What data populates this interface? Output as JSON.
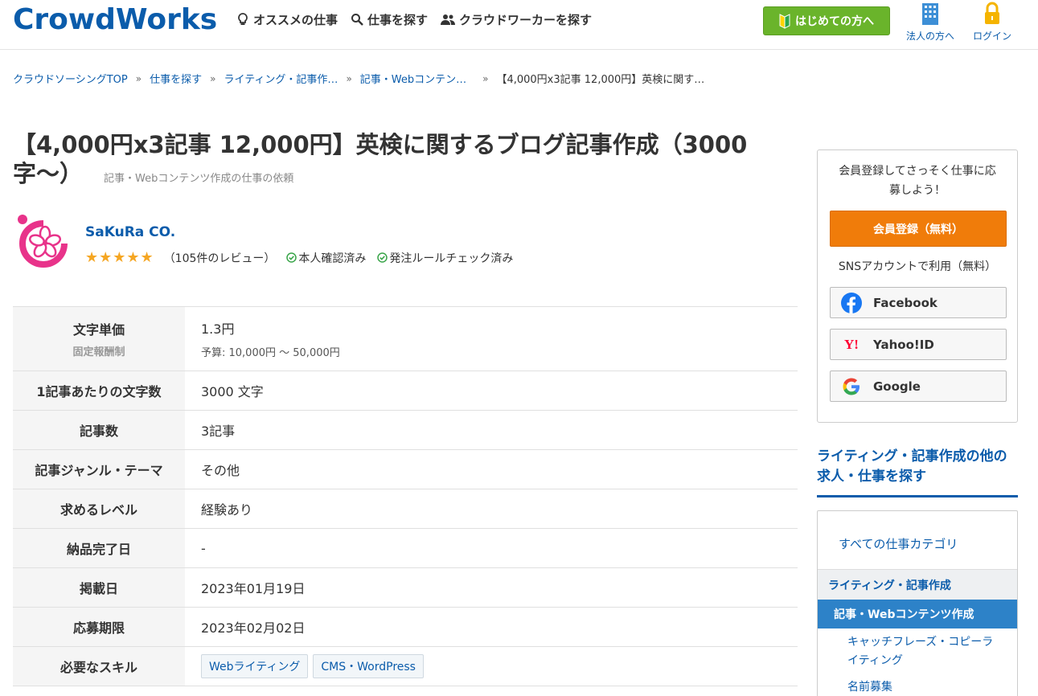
{
  "header": {
    "logo": "CrowdWorks",
    "nav": [
      {
        "label": "オススメの仕事",
        "icon": "lightbulb-icon"
      },
      {
        "label": "仕事を探す",
        "icon": "search-icon"
      },
      {
        "label": "クラウドワーカーを探す",
        "icon": "users-icon"
      }
    ],
    "first_button": "はじめての方へ",
    "corporate_label": "法人の方へ",
    "login_label": "ログイン",
    "accent_color": "#0b5cab",
    "first_button_color": "#6ab42b"
  },
  "breadcrumb": [
    {
      "label": "クラウドソーシングTOP"
    },
    {
      "label": "仕事を探す"
    },
    {
      "label": "ライティング・記事作…"
    },
    {
      "label": "記事・Webコンテン…"
    },
    {
      "label": "【4,000円x3記事 12,000円】英検に関す…"
    }
  ],
  "job": {
    "title": "【4,000円x3記事 12,000円】英検に関するブログ記事作成（3000字〜）",
    "category_note": "記事・Webコンテンツ作成の仕事の依頼"
  },
  "client": {
    "name": "SaKuRa CO.",
    "stars": "★★★★★",
    "reviews": "（105件のレビュー）",
    "identity_verified": "本人確認済み",
    "rule_checked": "発注ルールチェック済み",
    "rating": 5
  },
  "details": {
    "unit_price_label": "文字単価",
    "unit_price_sub": "固定報酬制",
    "unit_price_value": "1.3円",
    "budget": "予算: 10,000円 〜 50,000円",
    "chars_label": "1記事あたりの文字数",
    "chars_value": "3000 文字",
    "articles_label": "記事数",
    "articles_value": "3記事",
    "genre_label": "記事ジャンル・テーマ",
    "genre_value": "その他",
    "level_label": "求めるレベル",
    "level_value": "経験あり",
    "delivery_label": "納品完了日",
    "delivery_value": "-",
    "posted_label": "掲載日",
    "posted_value": "2023年01月19日",
    "deadline_label": "応募期限",
    "deadline_value": "2023年02月02日",
    "skills_label": "必要なスキル",
    "skills": [
      "Webライティング",
      "CMS・WordPress"
    ]
  },
  "sidebar": {
    "signup_message_1": "会員登録してさっそく仕事に応",
    "signup_message_2": "募しよう！",
    "register_button": "会員登録（無料）",
    "sns_label": "SNSアカウントで利用（無料）",
    "facebook": "Facebook",
    "yahoo": "Yahoo!ID",
    "google": "Google",
    "heading_1": "ライティング・記事作成の他の",
    "heading_2": "求人・仕事を探す",
    "cat_all": "すべての仕事カテゴリ",
    "cat_level1": "ライティング・記事作成",
    "cat_level2": "記事・Webコンテンツ作成",
    "cat_sub1_a": "キャッチフレーズ・コピーラ",
    "cat_sub1_b": "イティング",
    "cat_sub2": "名前募集",
    "register_color": "#f07c0a"
  }
}
